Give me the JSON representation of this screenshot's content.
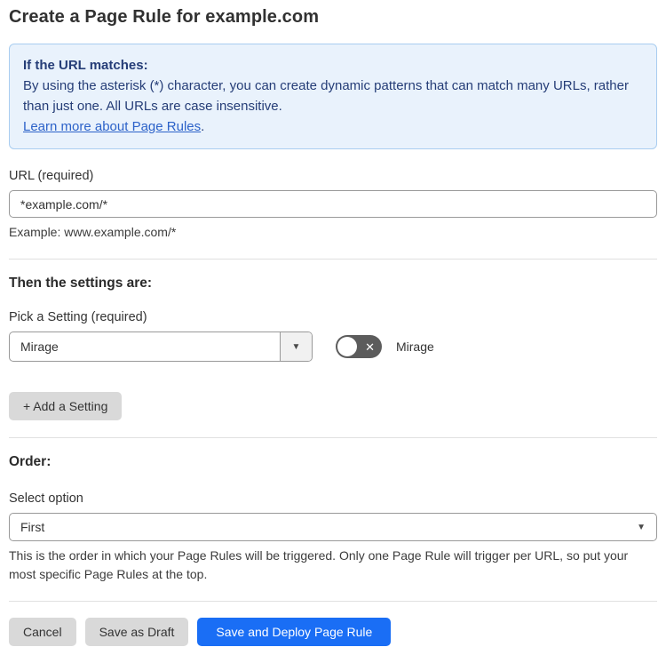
{
  "page": {
    "title": "Create a Page Rule for example.com"
  },
  "info_box": {
    "heading": "If the URL matches:",
    "body": "By using the asterisk (*) character, you can create dynamic patterns that can match many URLs, rather than just one. All URLs are case insensitive.",
    "link_label": "Learn more about Page Rules",
    "link_suffix": "."
  },
  "url_field": {
    "label": "URL (required)",
    "value": "*example.com/*",
    "helper": "Example: www.example.com/*"
  },
  "settings_section": {
    "heading": "Then the settings are:",
    "picker_label": "Pick a Setting (required)",
    "picker_value": "Mirage",
    "toggle_label": "Mirage",
    "toggle_state": "off",
    "toggle_icon": "✕",
    "caret_icon": "▼",
    "add_button_label": "+ Add a Setting"
  },
  "order_section": {
    "heading": "Order:",
    "select_label": "Select option",
    "select_value": "First",
    "caret_icon": "▼",
    "helper": "This is the order in which your Page Rules will be triggered. Only one Page Rule will trigger per URL, so put your most specific Page Rules at the top."
  },
  "footer": {
    "cancel_label": "Cancel",
    "save_draft_label": "Save as Draft",
    "save_deploy_label": "Save and Deploy Page Rule"
  },
  "colors": {
    "accent_blue": "#1a6ef5",
    "info_background": "#e9f2fc",
    "info_border": "#a9cdf0",
    "info_text": "#253d77",
    "link_blue": "#2c62c9",
    "toggle_off_gray": "#5c5c5c",
    "button_gray": "#d9d9d9",
    "divider_gray": "#e0e0e0"
  }
}
